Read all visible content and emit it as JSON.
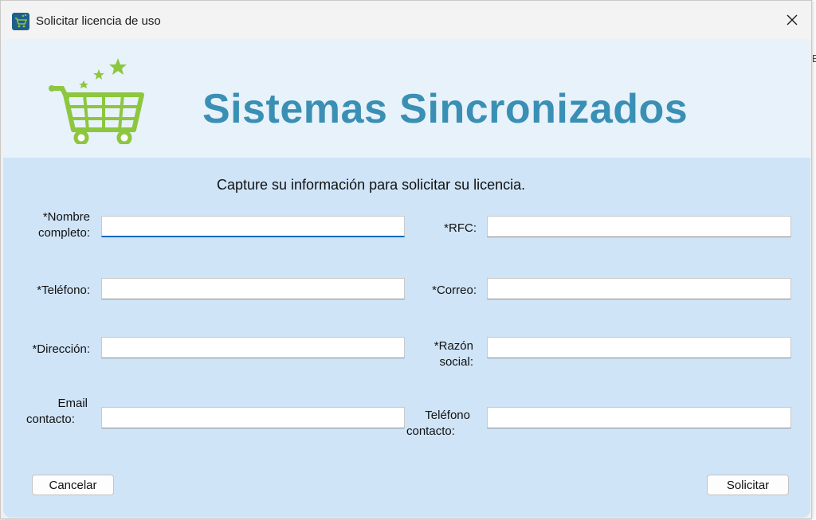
{
  "window": {
    "title": "Solicitar licencia de uso"
  },
  "background": {
    "edge_letter": "E"
  },
  "header": {
    "brand": "Sistemas Sincronizados",
    "logo_icon": "shopping-cart-stars-icon",
    "colors": {
      "cart": "#8dc63f",
      "brand_text": "#3a8fb4"
    }
  },
  "form": {
    "instruction": "Capture su información para solicitar su licencia.",
    "fields": {
      "nombre": {
        "label_line1": "*Nombre",
        "label_line2": "completo:",
        "value": ""
      },
      "rfc": {
        "label": "*RFC:",
        "value": ""
      },
      "telefono": {
        "label": "*Teléfono:",
        "value": ""
      },
      "correo": {
        "label": "*Correo:",
        "value": ""
      },
      "direccion": {
        "label": "*Dirección:",
        "value": ""
      },
      "razon": {
        "label_line1": "*Razón",
        "label_line2": "social:",
        "value": ""
      },
      "email_contacto": {
        "label_line1": "Email",
        "label_line2": "contacto:",
        "value": ""
      },
      "telefono_contacto": {
        "label_line1": "Teléfono",
        "label_line2": "contacto:",
        "value": ""
      }
    }
  },
  "buttons": {
    "cancel": "Cancelar",
    "submit": "Solicitar"
  }
}
